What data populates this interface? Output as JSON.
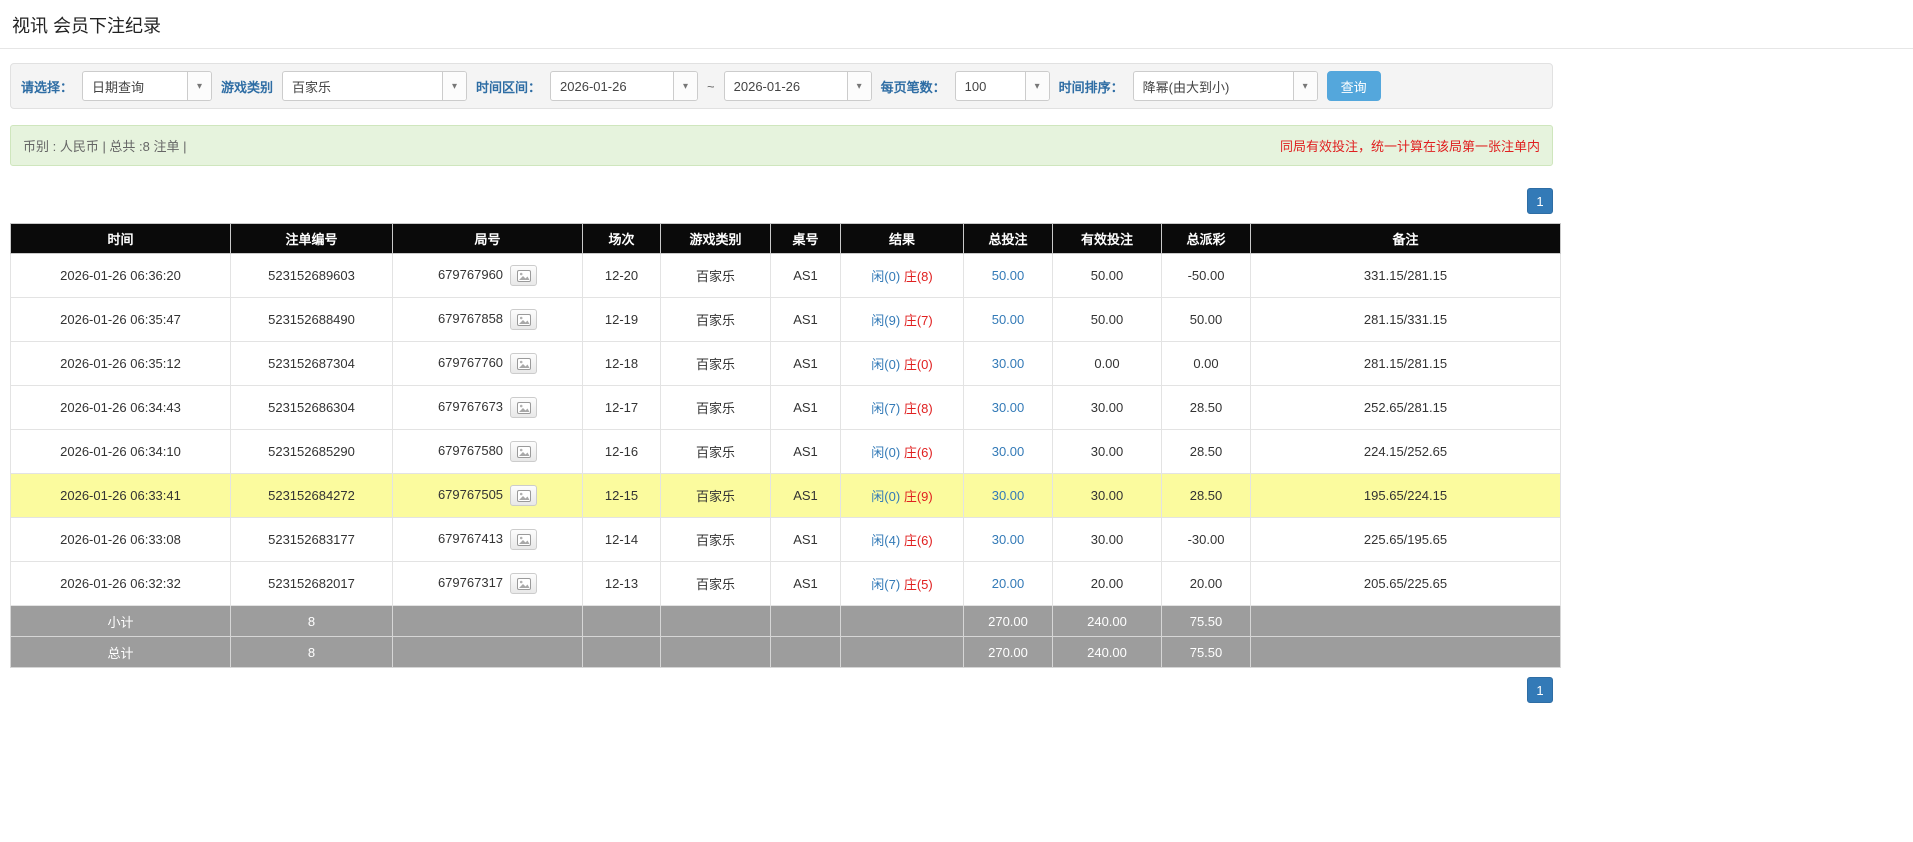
{
  "colors": {
    "accent": "#2e6da4",
    "link": "#337ab7",
    "danger": "#e02020",
    "highlight": "#fbfb9e",
    "header-bg": "#0a0a0a",
    "footer-bg": "#9d9d9d",
    "button-bg": "#54a7dc",
    "pagination-bg": "#337ab7",
    "summary-bg": "#e6f3dd",
    "summary-border": "#cfe6bd"
  },
  "icons": {
    "caret-down": "▾"
  },
  "page": {
    "title": "视讯 会员下注纪录"
  },
  "filters": {
    "select_label": "请选择：",
    "select_value": "日期查询",
    "game_label": "游戏类别",
    "game_value": "百家乐",
    "range_label": "时间区间：",
    "date_from": "2026-01-26",
    "range_separator": "~",
    "date_to": "2026-01-26",
    "per_page_label": "每页笔数：",
    "per_page_value": "100",
    "sort_label": "时间排序：",
    "sort_value": "降幂(由大到小)",
    "query_button": "查询"
  },
  "summary": {
    "currency_info": "币别 : 人民币 | 总共 :8 注单 |",
    "notice": "同局有效投注，统一计算在该局第一张注单内"
  },
  "pagination": {
    "page": "1"
  },
  "table": {
    "headers": [
      "时间",
      "注单编号",
      "局号",
      "场次",
      "游戏类别",
      "桌号",
      "结果",
      "总投注",
      "有效投注",
      "总派彩",
      "备注"
    ],
    "rows": [
      {
        "time": "2026-01-26 06:36:20",
        "bet_id": "523152689603",
        "round_id": "679767960",
        "session": "12-20",
        "game": "百家乐",
        "table_no": "AS1",
        "result_player": "闲(0)",
        "result_banker": "庄(8)",
        "total_bet": "50.00",
        "valid_bet": "50.00",
        "payout": "-50.00",
        "remark": "331.15/281.15",
        "highlight": false
      },
      {
        "time": "2026-01-26 06:35:47",
        "bet_id": "523152688490",
        "round_id": "679767858",
        "session": "12-19",
        "game": "百家乐",
        "table_no": "AS1",
        "result_player": "闲(9)",
        "result_banker": "庄(7)",
        "total_bet": "50.00",
        "valid_bet": "50.00",
        "payout": "50.00",
        "remark": "281.15/331.15",
        "highlight": false
      },
      {
        "time": "2026-01-26 06:35:12",
        "bet_id": "523152687304",
        "round_id": "679767760",
        "session": "12-18",
        "game": "百家乐",
        "table_no": "AS1",
        "result_player": "闲(0)",
        "result_banker": "庄(0)",
        "total_bet": "30.00",
        "valid_bet": "0.00",
        "payout": "0.00",
        "remark": "281.15/281.15",
        "highlight": false
      },
      {
        "time": "2026-01-26 06:34:43",
        "bet_id": "523152686304",
        "round_id": "679767673",
        "session": "12-17",
        "game": "百家乐",
        "table_no": "AS1",
        "result_player": "闲(7)",
        "result_banker": "庄(8)",
        "total_bet": "30.00",
        "valid_bet": "30.00",
        "payout": "28.50",
        "remark": "252.65/281.15",
        "highlight": false
      },
      {
        "time": "2026-01-26 06:34:10",
        "bet_id": "523152685290",
        "round_id": "679767580",
        "session": "12-16",
        "game": "百家乐",
        "table_no": "AS1",
        "result_player": "闲(0)",
        "result_banker": "庄(6)",
        "total_bet": "30.00",
        "valid_bet": "30.00",
        "payout": "28.50",
        "remark": "224.15/252.65",
        "highlight": false
      },
      {
        "time": "2026-01-26 06:33:41",
        "bet_id": "523152684272",
        "round_id": "679767505",
        "session": "12-15",
        "game": "百家乐",
        "table_no": "AS1",
        "result_player": "闲(0)",
        "result_banker": "庄(9)",
        "total_bet": "30.00",
        "valid_bet": "30.00",
        "payout": "28.50",
        "remark": "195.65/224.15",
        "highlight": true
      },
      {
        "time": "2026-01-26 06:33:08",
        "bet_id": "523152683177",
        "round_id": "679767413",
        "session": "12-14",
        "game": "百家乐",
        "table_no": "AS1",
        "result_player": "闲(4)",
        "result_banker": "庄(6)",
        "total_bet": "30.00",
        "valid_bet": "30.00",
        "payout": "-30.00",
        "remark": "225.65/195.65",
        "highlight": false
      },
      {
        "time": "2026-01-26 06:32:32",
        "bet_id": "523152682017",
        "round_id": "679767317",
        "session": "12-13",
        "game": "百家乐",
        "table_no": "AS1",
        "result_player": "闲(7)",
        "result_banker": "庄(5)",
        "total_bet": "20.00",
        "valid_bet": "20.00",
        "payout": "20.00",
        "remark": "205.65/225.65",
        "highlight": false
      }
    ],
    "subtotal": {
      "label": "小计",
      "count": "8",
      "total_bet": "270.00",
      "valid_bet": "240.00",
      "payout": "75.50"
    },
    "total": {
      "label": "总计",
      "count": "8",
      "total_bet": "270.00",
      "valid_bet": "240.00",
      "payout": "75.50"
    }
  }
}
